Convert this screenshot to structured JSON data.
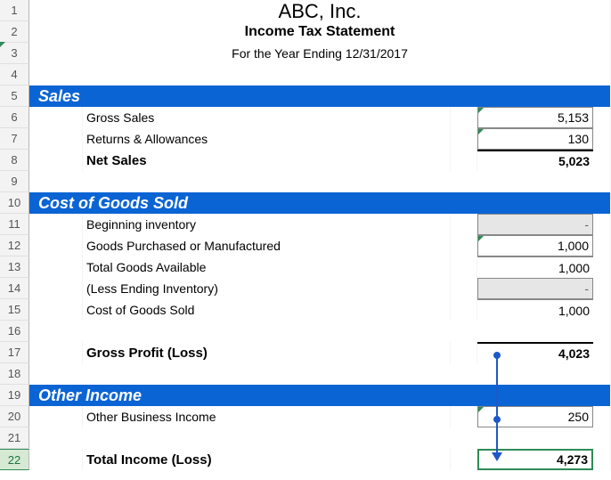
{
  "company": "ABC, Inc.",
  "subtitle": "Income Tax Statement",
  "period": "For the Year Ending 12/31/2017",
  "sections": {
    "sales": {
      "title": "Sales",
      "gross_sales_label": "Gross Sales",
      "gross_sales": "5,153",
      "returns_label": "Returns & Allowances",
      "returns": "130",
      "net_sales_label": "Net Sales",
      "net_sales": "5,023"
    },
    "cogs": {
      "title": "Cost of Goods Sold",
      "beg_inv_label": "Beginning inventory",
      "beg_inv": "-",
      "purchased_label": "Goods Purchased or Manufactured",
      "purchased": "1,000",
      "total_avail_label": "Total Goods Available",
      "total_avail": "1,000",
      "less_end_label": "(Less Ending Inventory)",
      "less_end": "-",
      "cogs_label": "Cost of Goods Sold",
      "cogs": "1,000",
      "gp_label": "Gross Profit (Loss)",
      "gp": "4,023"
    },
    "other": {
      "title": "Other Income",
      "oth_label": "Other Business Income",
      "oth": "250",
      "total_label": "Total Income (Loss)",
      "total": "4,273"
    }
  },
  "rows": [
    "1",
    "2",
    "3",
    "4",
    "5",
    "6",
    "7",
    "8",
    "9",
    "10",
    "11",
    "12",
    "13",
    "14",
    "15",
    "16",
    "17",
    "18",
    "19",
    "20",
    "21",
    "22"
  ],
  "chart_data": {
    "type": "table",
    "title": "ABC, Inc. Income Tax Statement — For the Year Ending 12/31/2017",
    "rows": [
      {
        "section": "Sales",
        "label": "Gross Sales",
        "value": 5153
      },
      {
        "section": "Sales",
        "label": "Returns & Allowances",
        "value": 130
      },
      {
        "section": "Sales",
        "label": "Net Sales",
        "value": 5023
      },
      {
        "section": "Cost of Goods Sold",
        "label": "Beginning inventory",
        "value": null
      },
      {
        "section": "Cost of Goods Sold",
        "label": "Goods Purchased or Manufactured",
        "value": 1000
      },
      {
        "section": "Cost of Goods Sold",
        "label": "Total Goods Available",
        "value": 1000
      },
      {
        "section": "Cost of Goods Sold",
        "label": "(Less Ending Inventory)",
        "value": null
      },
      {
        "section": "Cost of Goods Sold",
        "label": "Cost of Goods Sold",
        "value": 1000
      },
      {
        "section": "Cost of Goods Sold",
        "label": "Gross Profit (Loss)",
        "value": 4023
      },
      {
        "section": "Other Income",
        "label": "Other Business Income",
        "value": 250
      },
      {
        "section": "Other Income",
        "label": "Total Income (Loss)",
        "value": 4273
      }
    ]
  }
}
